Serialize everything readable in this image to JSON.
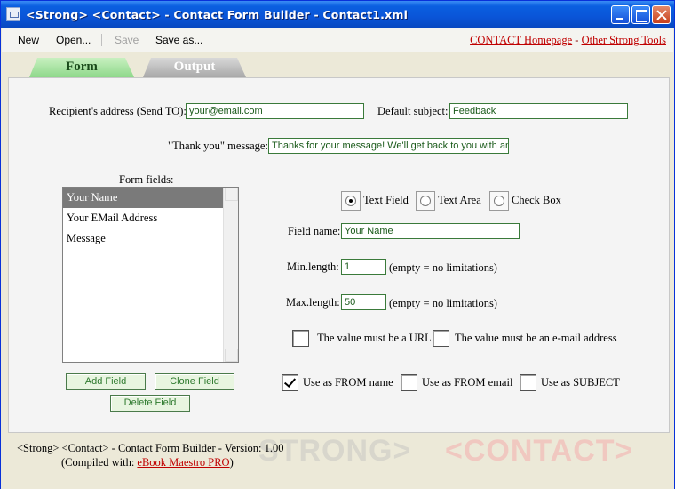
{
  "window": {
    "title": "<Strong> <Contact> - Contact Form Builder - Contact1.xml",
    "minimize_icon": "minimize-icon",
    "maximize_icon": "maximize-icon",
    "close_icon": "close-icon"
  },
  "toolbar": {
    "new_label": "New",
    "open_label": "Open...",
    "save_label": "Save",
    "save_as_label": "Save as...",
    "homepage_link": "CONTACT Homepage",
    "link_separator": "-",
    "other_tools_link": "Other Strong Tools"
  },
  "tabs": {
    "form": "Form",
    "output": "Output"
  },
  "form": {
    "recipient_label": "Recipient's address (Send TO):",
    "recipient_value": "your@email.com",
    "subject_label": "Default subject:",
    "subject_value": "Feedback",
    "thanks_label": "\"Thank you\" message:",
    "thanks_value": "Thanks for your message! We'll get back to you with an"
  },
  "fields_list": {
    "label": "Form fields:",
    "items": [
      "Your Name",
      "Your EMail Address",
      "Message"
    ],
    "selected": "Your Name",
    "add_button": "Add Field",
    "clone_button": "Clone Field",
    "delete_button": "Delete Field"
  },
  "field_editor": {
    "type_text_field": "Text Field",
    "type_text_area": "Text Area",
    "type_check_box": "Check Box",
    "selected_type": "Text Field",
    "name_label": "Field name:",
    "name_value": "Your Name",
    "min_label": "Min.length:",
    "min_value": "1",
    "min_hint": "(empty = no limitations)",
    "max_label": "Max.length:",
    "max_value": "50",
    "max_hint": "(empty = no limitations)",
    "url_check": "The value must be a URL",
    "email_check": "The value must be an e-mail address",
    "from_name_check": "Use as FROM name",
    "from_email_check": "Use as FROM email",
    "subject_check": "Use as SUBJECT",
    "checked": {
      "url": false,
      "email": false,
      "from_name": true,
      "from_email": false,
      "subject": false
    }
  },
  "footer": {
    "version_text": "<Strong> <Contact> - Contact Form Builder - Version: 1.00",
    "compiled_prefix": "(Compiled with: ",
    "compiled_link": "eBook Maestro PRO",
    "compiled_suffix": ")",
    "watermark_1": "STRONG>",
    "watermark_2": "<CONTACT>"
  },
  "colors": {
    "titlebar": "#0a55d8",
    "field_border": "#3a7a3a",
    "field_text": "#1a5a1a",
    "link": "#c00000",
    "tab_form": "#8ed88a",
    "tab_output": "#a8a8a8"
  }
}
